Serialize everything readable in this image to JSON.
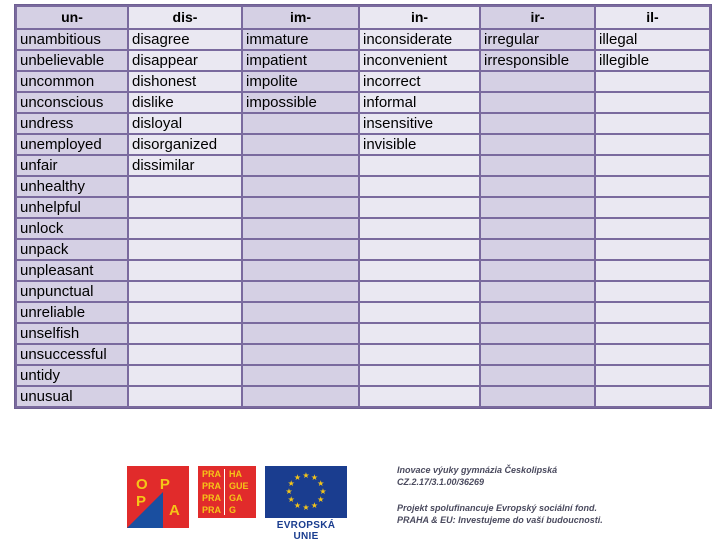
{
  "table": {
    "headers": [
      "un-",
      "dis-",
      "im-",
      "in-",
      "ir-",
      "il-"
    ],
    "columns": [
      [
        "unambitious",
        "unbelievable",
        "uncommon",
        "unconscious",
        "undress",
        "unemployed",
        "unfair",
        "unhealthy",
        "unhelpful",
        "unlock",
        "unpack",
        "unpleasant",
        "unpunctual",
        "unreliable",
        "unselfish",
        "unsuccessful",
        "untidy",
        "unusual"
      ],
      [
        "disagree",
        "disappear",
        "dishonest",
        "dislike",
        "disloyal",
        "disorganized",
        "dissimilar",
        "",
        "",
        "",
        "",
        "",
        "",
        "",
        "",
        "",
        "",
        ""
      ],
      [
        "immature",
        "impatient",
        "impolite",
        "impossible",
        "",
        "",
        "",
        "",
        "",
        "",
        "",
        "",
        "",
        "",
        "",
        "",
        "",
        ""
      ],
      [
        "inconsiderate",
        "inconvenient",
        "incorrect",
        "informal",
        "insensitive",
        "invisible",
        "",
        "",
        "",
        "",
        "",
        "",
        "",
        "",
        "",
        "",
        "",
        ""
      ],
      [
        "irregular",
        "irresponsible",
        "",
        "",
        "",
        "",
        "",
        "",
        "",
        "",
        "",
        "",
        "",
        "",
        "",
        "",
        "",
        ""
      ],
      [
        "illegal",
        "illegible",
        "",
        "",
        "",
        "",
        "",
        "",
        "",
        "",
        "",
        "",
        "",
        "",
        "",
        "",
        "",
        ""
      ]
    ],
    "row_count": 18,
    "border_color": "#7a6a9e",
    "cell_dark": "#d5d0e4",
    "cell_light": "#eae8f2"
  },
  "footer": {
    "opp_logo": {
      "line1": "O P P",
      "line2": "A",
      "bg_color": "#e12b2b",
      "text_color": "#f5c518",
      "triangle_color": "#1a4fa0"
    },
    "praha_logo": {
      "left_lines": [
        "PRA",
        "PRA",
        "PRA",
        "PRA"
      ],
      "right_lines": [
        "HA",
        "GUE",
        "GA",
        "G"
      ],
      "bg_color": "#e12b2b",
      "text_color": "#f5c518"
    },
    "eu_logo": {
      "caption": "EVROPSKÁ UNIE",
      "star_count": 12,
      "flag_color": "#1a3d8f",
      "star_color": "#f5c518"
    },
    "project": {
      "line1": "Inovace výuky gymnázia Českolipská",
      "line2": "CZ.2.17/3.1.00/36269",
      "line3": "Projekt spolufinancuje Evropský sociální fond.",
      "line4": "PRAHA & EU: Investujeme do vaší budoucnosti."
    }
  }
}
